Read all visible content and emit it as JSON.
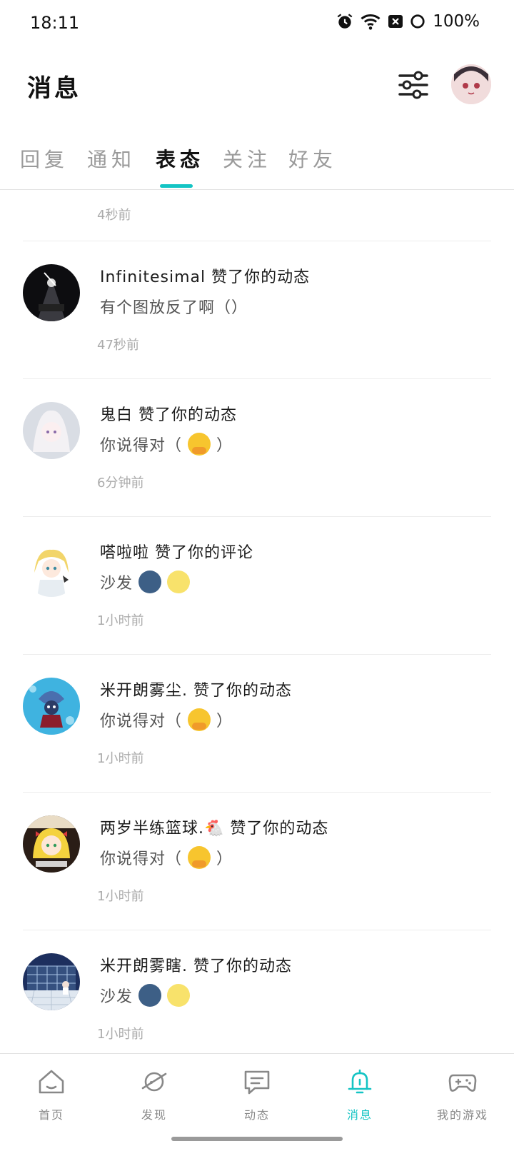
{
  "status": {
    "time": "18:11",
    "battery": "100%"
  },
  "header": {
    "title": "消息"
  },
  "tabs": [
    {
      "label": "回复"
    },
    {
      "label": "通知"
    },
    {
      "label": "表态"
    },
    {
      "label": "关注"
    },
    {
      "label": "好友"
    }
  ],
  "active_tab": "表态",
  "notifications": [
    {
      "time": "4秒前"
    },
    {
      "actor": "Infinitesimal",
      "action": "赞了你的动态",
      "content": "有个图放反了啊（）",
      "emojis": [],
      "time": "47秒前"
    },
    {
      "actor": "鬼白",
      "action": "赞了你的动态",
      "content": "你说得对（",
      "content_end": "）",
      "emojis": [
        "hug"
      ],
      "time": "6分钟前"
    },
    {
      "actor": "嗒啦啦",
      "action": "赞了你的评论",
      "content": "沙发",
      "content_end": "",
      "emojis": [
        "new-moon-face",
        "full-moon-face"
      ],
      "time": "1小时前"
    },
    {
      "actor": "米开朗雾尘.",
      "action": "赞了你的动态",
      "content": "你说得对（",
      "content_end": "）",
      "emojis": [
        "hug"
      ],
      "time": "1小时前"
    },
    {
      "actor": "两岁半练篮球.🐔",
      "action": "赞了你的动态",
      "content": "你说得对（",
      "content_end": "）",
      "emojis": [
        "hug"
      ],
      "time": "1小时前"
    },
    {
      "actor": "米开朗雾瞎.",
      "action": "赞了你的动态",
      "content": "沙发",
      "content_end": "",
      "emojis": [
        "new-moon-face",
        "full-moon-face"
      ],
      "time": "1小时前"
    }
  ],
  "bottom_nav": [
    {
      "label": "首页",
      "icon": "home-icon"
    },
    {
      "label": "发现",
      "icon": "planet-icon"
    },
    {
      "label": "动态",
      "icon": "chat-icon"
    },
    {
      "label": "消息",
      "icon": "bell-icon"
    },
    {
      "label": "我的游戏",
      "icon": "gamepad-icon"
    }
  ],
  "colors": {
    "accent": "#14c4c4"
  }
}
